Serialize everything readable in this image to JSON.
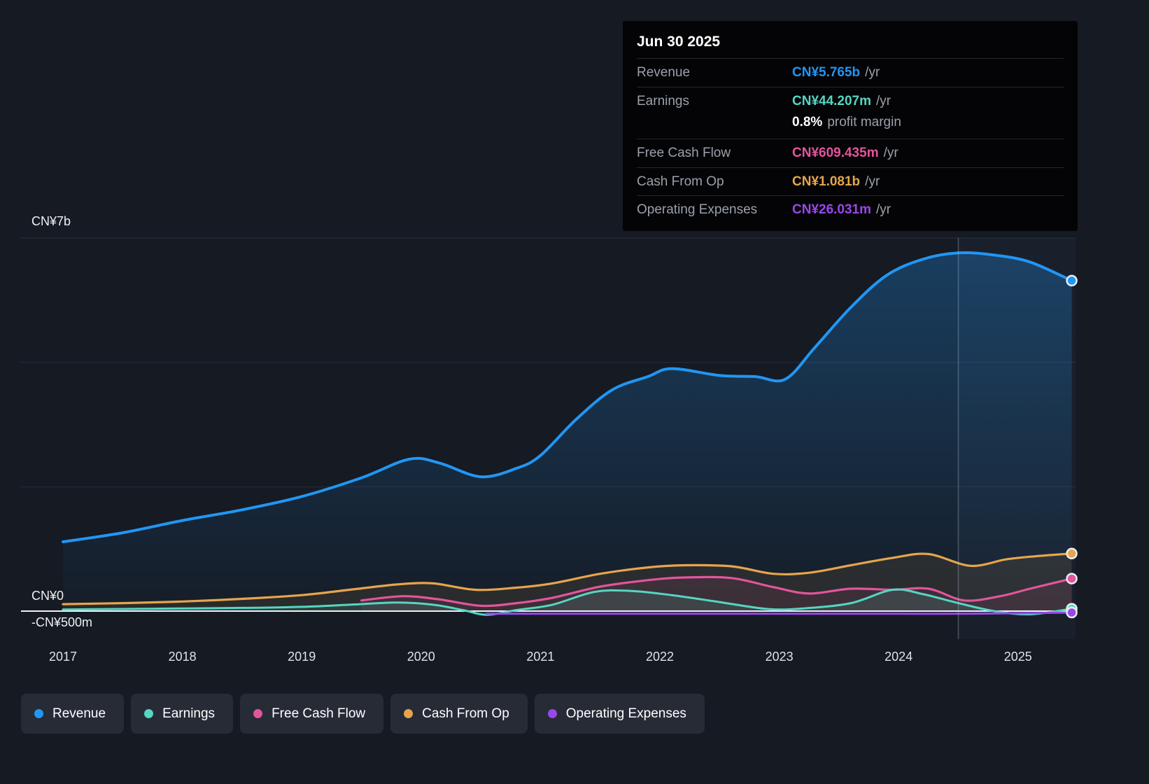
{
  "colors": {
    "revenue": "#2296f3",
    "earnings": "#56d5c3",
    "fcf": "#e1559c",
    "cashop": "#e6a54c",
    "opex": "#9947ea",
    "zero_line": "#eef1f5",
    "grid_line": "#262d3a"
  },
  "tooltip": {
    "date": "Jun 30 2025",
    "rows": [
      {
        "label": "Revenue",
        "value": "CN¥5.765b",
        "suffix": "/yr",
        "color_key": "revenue"
      },
      {
        "label": "Earnings",
        "value": "CN¥44.207m",
        "suffix": "/yr",
        "color_key": "earnings",
        "sub_value": "0.8%",
        "sub_suffix": "profit margin"
      },
      {
        "label": "Free Cash Flow",
        "value": "CN¥609.435m",
        "suffix": "/yr",
        "color_key": "fcf"
      },
      {
        "label": "Cash From Op",
        "value": "CN¥1.081b",
        "suffix": "/yr",
        "color_key": "cashop"
      },
      {
        "label": "Operating Expenses",
        "value": "CN¥26.031m",
        "suffix": "/yr",
        "color_key": "opex"
      }
    ]
  },
  "legend": {
    "items": [
      {
        "key": "revenue",
        "label": "Revenue"
      },
      {
        "key": "earnings",
        "label": "Earnings"
      },
      {
        "key": "fcf",
        "label": "Free Cash Flow"
      },
      {
        "key": "cashop",
        "label": "Cash From Op"
      },
      {
        "key": "opex",
        "label": "Operating Expenses"
      }
    ]
  },
  "chart_data": {
    "type": "area",
    "currency_unit": "CN¥ billions",
    "divider_year": 2024.5,
    "y_axis": {
      "labels": [
        "CN¥7b",
        "CN¥0",
        "-CN¥500m"
      ],
      "range_b": [
        -0.5,
        7
      ],
      "gridlines_b": [
        7,
        4.667,
        2.333
      ]
    },
    "x_axis": {
      "years": [
        "2017",
        "2018",
        "2019",
        "2020",
        "2021",
        "2022",
        "2023",
        "2024",
        "2025"
      ]
    },
    "series": [
      {
        "name": "Revenue",
        "key": "revenue",
        "area": true,
        "x": [
          2017,
          2017.5,
          2018,
          2018.5,
          2019,
          2019.5,
          2019.9,
          2020.15,
          2020.5,
          2020.8,
          2021,
          2021.3,
          2021.6,
          2021.9,
          2022.1,
          2022.5,
          2022.8,
          2023.05,
          2023.3,
          2023.6,
          2023.9,
          2024.2,
          2024.5,
          2024.8,
          2025.1,
          2025.45
        ],
        "y": [
          1.3,
          1.47,
          1.7,
          1.9,
          2.15,
          2.5,
          2.85,
          2.78,
          2.52,
          2.68,
          2.92,
          3.6,
          4.15,
          4.4,
          4.55,
          4.42,
          4.4,
          4.35,
          4.95,
          5.7,
          6.3,
          6.6,
          6.72,
          6.68,
          6.55,
          6.2
        ]
      },
      {
        "name": "Cash From Op",
        "key": "cashop",
        "area": true,
        "x": [
          2017,
          2017.5,
          2018,
          2018.5,
          2019,
          2019.4,
          2019.8,
          2020.1,
          2020.45,
          2020.8,
          2021.1,
          2021.5,
          2021.9,
          2022.2,
          2022.6,
          2022.95,
          2023.25,
          2023.6,
          2023.95,
          2024.25,
          2024.6,
          2024.9,
          2025.15,
          2025.45
        ],
        "y": [
          0.13,
          0.15,
          0.18,
          0.23,
          0.3,
          0.4,
          0.5,
          0.52,
          0.4,
          0.44,
          0.52,
          0.7,
          0.82,
          0.86,
          0.84,
          0.7,
          0.72,
          0.86,
          1.0,
          1.07,
          0.85,
          0.97,
          1.03,
          1.08
        ]
      },
      {
        "name": "Free Cash Flow",
        "key": "fcf",
        "area": true,
        "x": [
          2019.5,
          2019.85,
          2020.15,
          2020.5,
          2020.8,
          2021.1,
          2021.5,
          2021.9,
          2022.2,
          2022.6,
          2022.95,
          2023.25,
          2023.6,
          2023.95,
          2024.25,
          2024.55,
          2024.85,
          2025.1,
          2025.45
        ],
        "y": [
          0.2,
          0.28,
          0.22,
          0.1,
          0.15,
          0.25,
          0.46,
          0.58,
          0.63,
          0.62,
          0.45,
          0.33,
          0.42,
          0.4,
          0.42,
          0.2,
          0.28,
          0.42,
          0.61
        ]
      },
      {
        "name": "Earnings",
        "key": "earnings",
        "area": true,
        "x": [
          2017,
          2017.5,
          2018,
          2018.5,
          2019,
          2019.4,
          2019.8,
          2020.1,
          2020.35,
          2020.55,
          2020.8,
          2021.1,
          2021.45,
          2021.75,
          2022.1,
          2022.5,
          2022.9,
          2023.2,
          2023.6,
          2023.95,
          2024.2,
          2024.5,
          2024.8,
          2025.1,
          2025.45
        ],
        "y": [
          0.03,
          0.04,
          0.05,
          0.06,
          0.08,
          0.12,
          0.16,
          0.12,
          0.02,
          -0.07,
          0.02,
          0.12,
          0.36,
          0.38,
          0.3,
          0.17,
          0.04,
          0.05,
          0.15,
          0.4,
          0.32,
          0.15,
          0.0,
          -0.06,
          0.044
        ]
      },
      {
        "name": "Operating Expenses",
        "key": "opex",
        "area": false,
        "x": [
          2020.55,
          2021,
          2021.5,
          2022,
          2022.5,
          2023,
          2023.5,
          2024,
          2024.5,
          2025,
          2025.45
        ],
        "y": [
          -0.05,
          -0.05,
          -0.05,
          -0.05,
          -0.05,
          -0.05,
          -0.05,
          -0.05,
          -0.05,
          -0.04,
          -0.026
        ]
      }
    ]
  }
}
